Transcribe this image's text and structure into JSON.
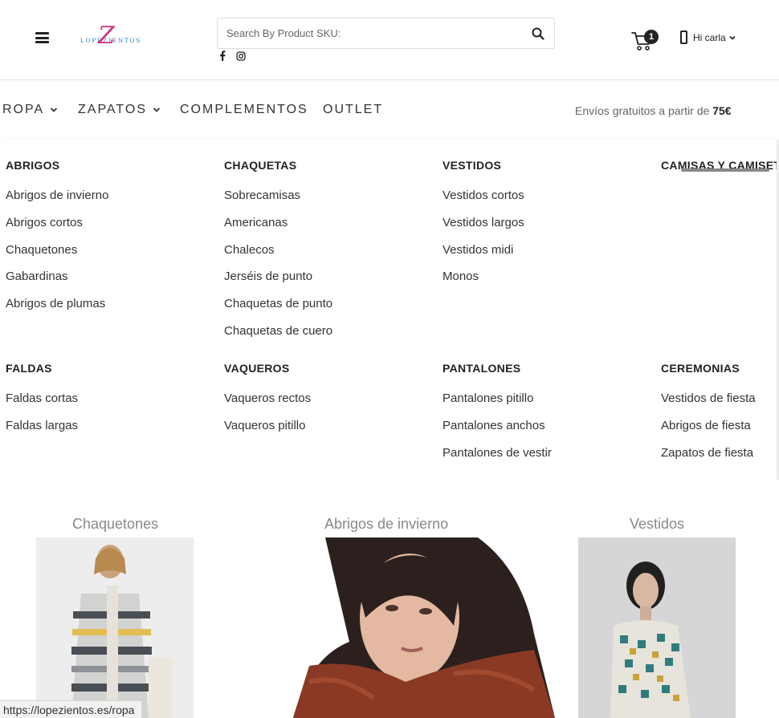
{
  "header": {
    "logo_text": "LOPEZIENTOS",
    "logo_letter": "Z",
    "search_placeholder": "Search By Product SKU:",
    "cart_count": "1",
    "user_label": "Hi carla"
  },
  "nav": {
    "items": [
      {
        "label": "ROPA",
        "has_dropdown": true
      },
      {
        "label": "ZAPATOS",
        "has_dropdown": true
      },
      {
        "label": "COMPLEMENTOS",
        "has_dropdown": false
      },
      {
        "label": "OUTLET",
        "has_dropdown": false
      }
    ],
    "shipping_text": "Envíos gratuitos a partir de ",
    "shipping_amount": "75€"
  },
  "mega_menu": {
    "columns": [
      {
        "title": "ABRIGOS",
        "items": [
          "Abrigos de invierno",
          "Abrigos cortos",
          "Chaquetones",
          "Gabardinas",
          "Abrigos de plumas"
        ]
      },
      {
        "title": "CHAQUETAS",
        "items": [
          "Sobrecamisas",
          "Americanas",
          "Chalecos",
          "Jerséis de punto",
          "Chaquetas de punto",
          "Chaquetas de cuero"
        ]
      },
      {
        "title": "VESTIDOS",
        "items": [
          "Vestidos cortos",
          "Vestidos largos",
          "Vestidos midi",
          "Monos"
        ]
      },
      {
        "title": "CAMISAS Y CAMISETA",
        "items": []
      },
      {
        "title": "FALDAS",
        "items": [
          "Faldas cortas",
          "Faldas largas"
        ]
      },
      {
        "title": "VAQUEROS",
        "items": [
          "Vaqueros rectos",
          "Vaqueros pitillo"
        ]
      },
      {
        "title": "PANTALONES",
        "items": [
          "Pantalones pitillo",
          "Pantalones anchos",
          "Pantalones de vestir"
        ]
      },
      {
        "title": "CEREMONIAS",
        "items": [
          "Vestidos de fiesta",
          "Abrigos de fiesta",
          "Zapatos de fiesta"
        ]
      }
    ]
  },
  "categories": [
    {
      "title": "Chaquetones"
    },
    {
      "title": "Abrigos de invierno"
    },
    {
      "title": "Vestidos"
    }
  ],
  "status_url": "https://lopezientos.es/ropa",
  "colors": {
    "logo_pink": "#d6307a",
    "logo_blue": "#1a7fd1",
    "text_dark": "#222222",
    "muted": "#888888"
  }
}
